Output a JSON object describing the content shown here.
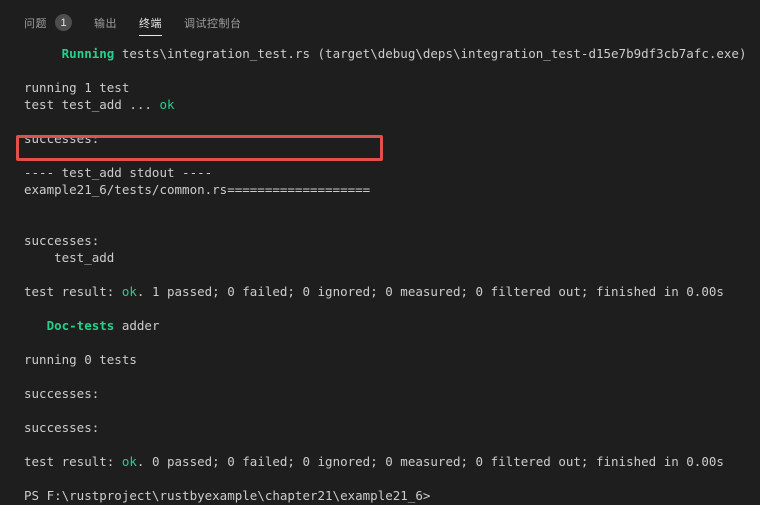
{
  "tabs": {
    "problems": "问题",
    "problems_count": "1",
    "output": "输出",
    "terminal": "终端",
    "debug_console": "调试控制台"
  },
  "terminal": {
    "running_label": "Running",
    "running_path": "tests\\integration_test.rs (target\\debug\\deps\\integration_test-d15e7b9df3cb7afc.exe)",
    "running_1_test": "running 1 test",
    "test_add_prefix": "test test_add ... ",
    "ok": "ok",
    "successes_1": "successes:",
    "stdout_header": "---- test_add stdout ----",
    "common_output": "example21_6/tests/common.rs===================",
    "successes_2": "successes:",
    "test_add_name": "    test_add",
    "result1_prefix": "test result: ",
    "result1_ok": "ok",
    "result1_rest": ". 1 passed; 0 failed; 0 ignored; 0 measured; 0 filtered out; finished in 0.00s",
    "doc_tests_label": "Doc-tests",
    "doc_tests_crate": " adder",
    "running_0_tests": "running 0 tests",
    "successes_3": "successes:",
    "successes_4": "successes:",
    "result2_prefix": "test result: ",
    "result2_ok": "ok",
    "result2_rest": ". 0 passed; 0 failed; 0 ignored; 0 measured; 0 filtered out; finished in 0.00s",
    "prompt": "PS F:\\rustproject\\rustbyexample\\chapter21\\example21_6>"
  },
  "colors": {
    "background": "#1e1e1e",
    "text": "#cccccc",
    "success_green": "#23d18b",
    "highlight_red": "#e2504c"
  }
}
